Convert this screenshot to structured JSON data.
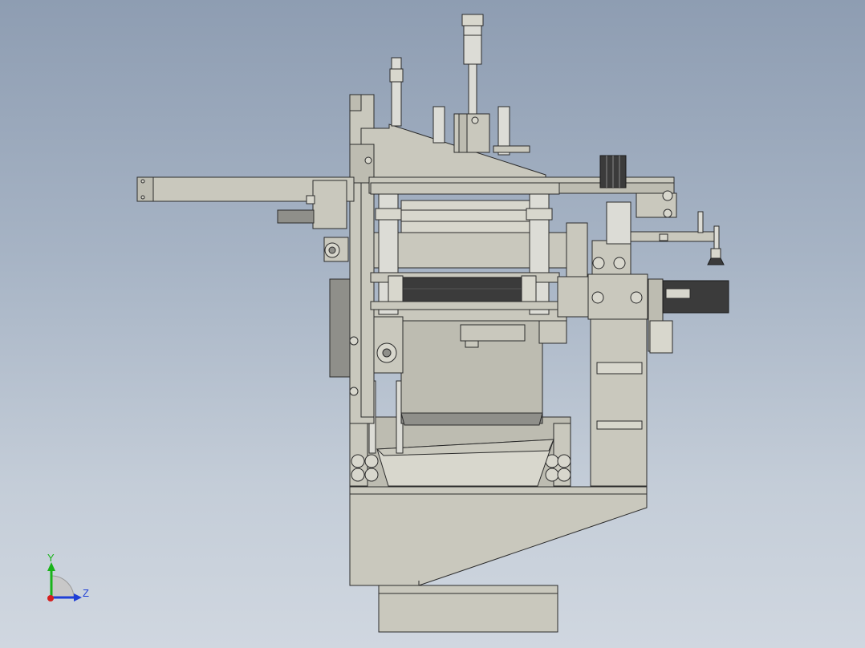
{
  "triad": {
    "y_label": "Y",
    "z_label": "Z",
    "colors": {
      "y": "#19b319",
      "z": "#1f3fd6",
      "x": "#d61f1f"
    }
  },
  "palette": {
    "background_top": "#8e9db2",
    "background_bottom": "#d0d7e0",
    "metal": "#c9c8bd",
    "edge": "#2b2b2b",
    "motor": "#3b3b3b"
  }
}
